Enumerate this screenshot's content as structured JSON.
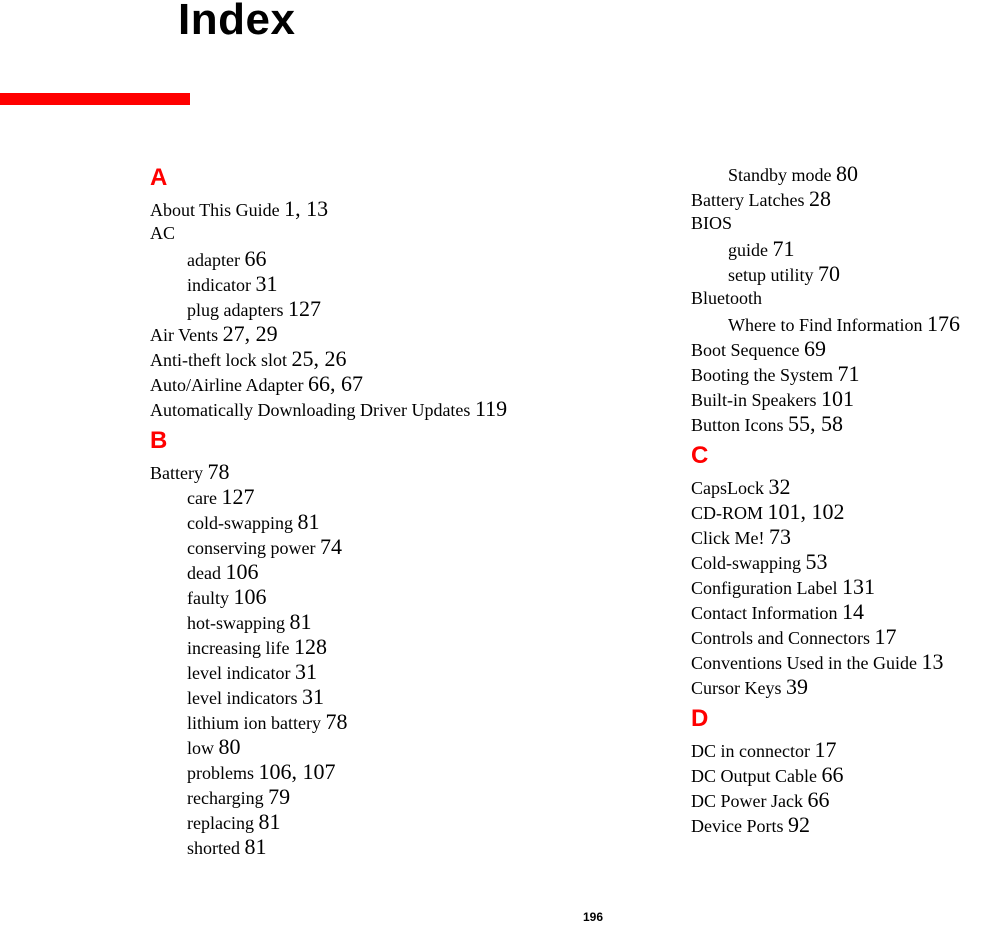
{
  "page": {
    "title": "Index",
    "accent_color": "#ff0000",
    "page_number": "196"
  },
  "left_column": [
    {
      "type": "letter",
      "text": "A"
    },
    {
      "type": "entry",
      "level": 0,
      "term": "About This Guide",
      "pages": "1, 13"
    },
    {
      "type": "entry",
      "level": 0,
      "term": "AC",
      "pages": ""
    },
    {
      "type": "entry",
      "level": 1,
      "term": "adapter",
      "pages": "66"
    },
    {
      "type": "entry",
      "level": 1,
      "term": "indicator",
      "pages": "31"
    },
    {
      "type": "entry",
      "level": 1,
      "term": "plug adapters",
      "pages": "127"
    },
    {
      "type": "entry",
      "level": 0,
      "term": "Air Vents",
      "pages": "27, 29"
    },
    {
      "type": "entry",
      "level": 0,
      "term": "Anti-theft lock slot",
      "pages": "25, 26"
    },
    {
      "type": "entry",
      "level": 0,
      "term": "Auto/Airline Adapter",
      "pages": "66, 67"
    },
    {
      "type": "entry",
      "level": 0,
      "term": "Automatically Downloading Driver Updates",
      "pages": "119"
    },
    {
      "type": "gap"
    },
    {
      "type": "letter",
      "text": "B"
    },
    {
      "type": "entry",
      "level": 0,
      "term": "Battery",
      "pages": "78"
    },
    {
      "type": "entry",
      "level": 1,
      "term": "care",
      "pages": "127"
    },
    {
      "type": "entry",
      "level": 1,
      "term": "cold-swapping",
      "pages": "81"
    },
    {
      "type": "entry",
      "level": 1,
      "term": "conserving power",
      "pages": "74"
    },
    {
      "type": "entry",
      "level": 1,
      "term": "dead",
      "pages": "106"
    },
    {
      "type": "entry",
      "level": 1,
      "term": "faulty",
      "pages": "106"
    },
    {
      "type": "entry",
      "level": 1,
      "term": "hot-swapping",
      "pages": "81"
    },
    {
      "type": "entry",
      "level": 1,
      "term": "increasing life",
      "pages": "128"
    },
    {
      "type": "entry",
      "level": 1,
      "term": "level indicator",
      "pages": "31"
    },
    {
      "type": "entry",
      "level": 1,
      "term": "level indicators",
      "pages": "31"
    },
    {
      "type": "entry",
      "level": 1,
      "term": "lithium ion battery",
      "pages": "78"
    },
    {
      "type": "entry",
      "level": 1,
      "term": "low",
      "pages": "80"
    },
    {
      "type": "entry",
      "level": 1,
      "term": "problems",
      "pages": "106, 107"
    },
    {
      "type": "entry",
      "level": 1,
      "term": "recharging",
      "pages": "79"
    },
    {
      "type": "entry",
      "level": 1,
      "term": "replacing",
      "pages": "81"
    },
    {
      "type": "entry",
      "level": 1,
      "term": "shorted",
      "pages": "81"
    }
  ],
  "right_column": [
    {
      "type": "entry",
      "level": 1,
      "term": "Standby mode",
      "pages": "80"
    },
    {
      "type": "entry",
      "level": 0,
      "term": "Battery Latches",
      "pages": "28"
    },
    {
      "type": "entry",
      "level": 0,
      "term": "BIOS",
      "pages": ""
    },
    {
      "type": "entry",
      "level": 1,
      "term": "guide",
      "pages": "71"
    },
    {
      "type": "entry",
      "level": 1,
      "term": "setup utility",
      "pages": "70"
    },
    {
      "type": "entry",
      "level": 0,
      "term": "Bluetooth",
      "pages": ""
    },
    {
      "type": "entry",
      "level": 1,
      "term": "Where to Find Information",
      "pages": "176"
    },
    {
      "type": "entry",
      "level": 0,
      "term": "Boot Sequence",
      "pages": "69"
    },
    {
      "type": "entry",
      "level": 0,
      "term": "Booting the System",
      "pages": "71"
    },
    {
      "type": "entry",
      "level": 0,
      "term": "Built-in Speakers",
      "pages": "101"
    },
    {
      "type": "entry",
      "level": 0,
      "term": "Button Icons",
      "pages": "55, 58"
    },
    {
      "type": "gap"
    },
    {
      "type": "letter",
      "text": "C"
    },
    {
      "type": "entry",
      "level": 0,
      "term": "CapsLock",
      "pages": "32"
    },
    {
      "type": "entry",
      "level": 0,
      "term": "CD-ROM",
      "pages": "101, 102"
    },
    {
      "type": "entry",
      "level": 0,
      "term": "Click Me!",
      "pages": "73"
    },
    {
      "type": "entry",
      "level": 0,
      "term": "Cold-swapping",
      "pages": "53"
    },
    {
      "type": "entry",
      "level": 0,
      "term": "Configuration Label",
      "pages": "131"
    },
    {
      "type": "entry",
      "level": 0,
      "term": "Contact Information",
      "pages": "14"
    },
    {
      "type": "entry",
      "level": 0,
      "term": "Controls and Connectors",
      "pages": "17"
    },
    {
      "type": "entry",
      "level": 0,
      "term": "Conventions Used in the Guide",
      "pages": "13"
    },
    {
      "type": "entry",
      "level": 0,
      "term": "Cursor Keys",
      "pages": "39"
    },
    {
      "type": "gap"
    },
    {
      "type": "letter",
      "text": "D"
    },
    {
      "type": "entry",
      "level": 0,
      "term": "DC in connector",
      "pages": "17"
    },
    {
      "type": "entry",
      "level": 0,
      "term": "DC Output Cable",
      "pages": "66"
    },
    {
      "type": "entry",
      "level": 0,
      "term": "DC Power Jack",
      "pages": "66"
    },
    {
      "type": "entry",
      "level": 0,
      "term": "Device Ports",
      "pages": "92"
    }
  ]
}
